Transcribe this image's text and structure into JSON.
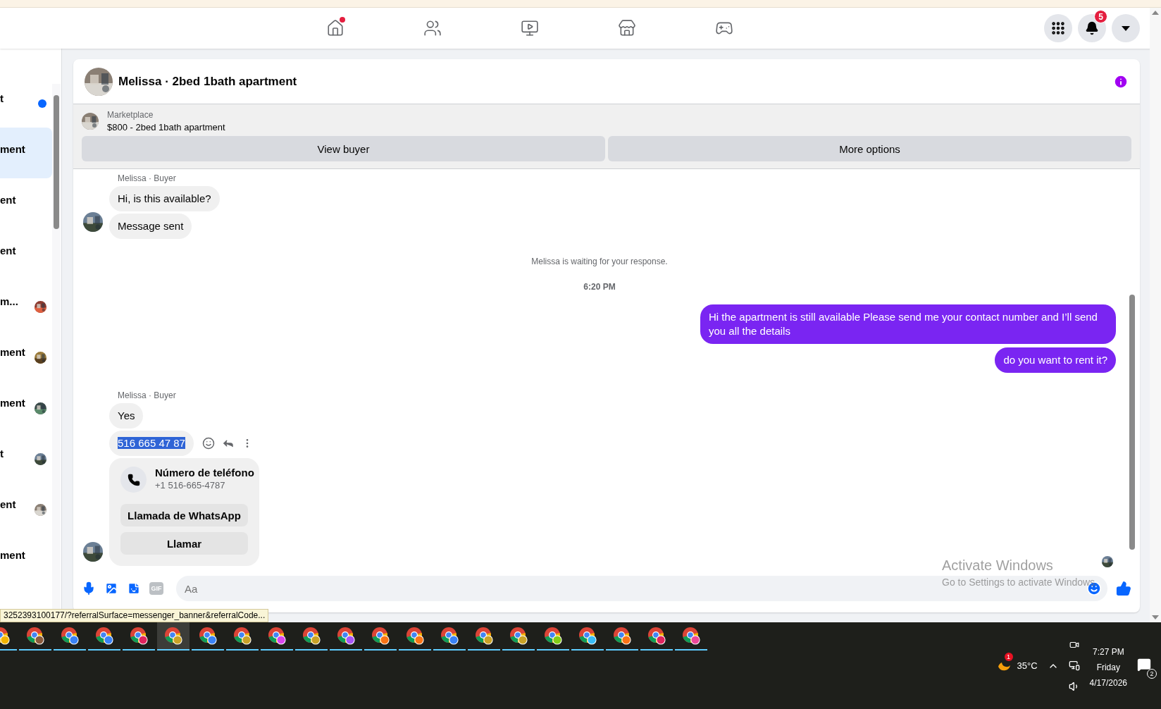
{
  "nav": [
    {
      "kind": "home",
      "dot": true
    },
    {
      "kind": "friends",
      "dot": false
    },
    {
      "kind": "video",
      "dot": false
    },
    {
      "kind": "marketplace",
      "dot": false
    },
    {
      "kind": "gaming",
      "dot": false
    }
  ],
  "account": {
    "notifications": "5"
  },
  "sidebar": {
    "items": [
      {
        "label": "t",
        "unread": true,
        "selected": false,
        "avatar": false
      },
      {
        "label": "ment",
        "unread": false,
        "selected": true,
        "avatar": false
      },
      {
        "label": "ent",
        "unread": false,
        "selected": false,
        "avatar": false
      },
      {
        "label": "ent",
        "unread": false,
        "selected": false,
        "avatar": false
      },
      {
        "label": "m...",
        "unread": false,
        "selected": false,
        "avatar": true
      },
      {
        "label": "ment",
        "unread": false,
        "selected": false,
        "avatar": true
      },
      {
        "label": "ment",
        "unread": false,
        "selected": false,
        "avatar": true
      },
      {
        "label": "t",
        "unread": false,
        "selected": false,
        "avatar": true
      },
      {
        "label": "ent",
        "unread": false,
        "selected": false,
        "avatar": true
      },
      {
        "label": "ment",
        "unread": false,
        "selected": false,
        "avatar": false
      }
    ]
  },
  "chat": {
    "title": "Melissa · 2bed 1bath apartment",
    "listing": {
      "source": "Marketplace",
      "title": "$800 - 2bed 1bath apartment",
      "buttons": [
        "View buyer",
        "More options"
      ]
    },
    "messages": [
      {
        "kind": "incoming",
        "sender": "Melissa · Buyer",
        "bubbles": [
          {
            "text": "Hi, is this available?",
            "selected": false
          },
          {
            "text": "Message sent",
            "selected": false
          }
        ]
      },
      {
        "kind": "notice",
        "text": "Melissa is waiting for your response."
      },
      {
        "kind": "time",
        "text": "6:20 PM"
      },
      {
        "kind": "outgoing",
        "bubbles": [
          {
            "text": "Hi the apartment is still available Please send me your contact number and I’ll send you all the details",
            "selected": false
          },
          {
            "text": "do you want to rent it?",
            "selected": false
          }
        ]
      },
      {
        "kind": "incoming",
        "sender": "Melissa · Buyer",
        "bubbles": [
          {
            "text": "Yes",
            "selected": false
          },
          {
            "text": "516 665 47 87",
            "selected": true
          }
        ],
        "card": {
          "title": "Número de teléfono",
          "subtitle": "+1 516-665-4787",
          "buttons": [
            "Llamada de WhatsApp",
            "Llamar"
          ]
        }
      }
    ],
    "composer": {
      "placeholder": "Aa",
      "gif": "GIF"
    }
  },
  "status_url": "3252393100177/?referralSurface=messenger_banner&referralCode...",
  "activation": {
    "title": "Activate Windows",
    "text": "Go to Settings to activate Windows."
  },
  "taskbar": {
    "apps": [
      {
        "color": "#f2b400",
        "selected": false
      },
      {
        "color": "#8a5a3c",
        "selected": false
      },
      {
        "color": "#3b82f6",
        "selected": false
      },
      {
        "color": "#3b82f6",
        "selected": false
      },
      {
        "color": "#e0245e",
        "selected": false
      },
      {
        "color": "#c9a227",
        "selected": true
      },
      {
        "color": "#3b82f6",
        "selected": false
      },
      {
        "color": "#c9a227",
        "selected": false
      },
      {
        "color": "#d946ef",
        "selected": false
      },
      {
        "color": "#c9a227",
        "selected": false
      },
      {
        "color": "#a855f7",
        "selected": false
      },
      {
        "color": "#f97316",
        "selected": false
      },
      {
        "color": "#f97316",
        "selected": false
      },
      {
        "color": "#3b82f6",
        "selected": false
      },
      {
        "color": "#c9a227",
        "selected": false
      },
      {
        "color": "#c9a227",
        "selected": false
      },
      {
        "color": "#84cc16",
        "selected": false
      },
      {
        "color": "#38bdf8",
        "selected": false
      },
      {
        "color": "#f97316",
        "selected": false
      },
      {
        "color": "#e0245e",
        "selected": false
      },
      {
        "color": "#ec4899",
        "selected": false
      }
    ],
    "weather": {
      "temp": "35°C",
      "badge": "1"
    },
    "clock": {
      "time": "7:27 PM",
      "day": "Friday",
      "date": "4/17/2026"
    },
    "notifications": "2"
  }
}
